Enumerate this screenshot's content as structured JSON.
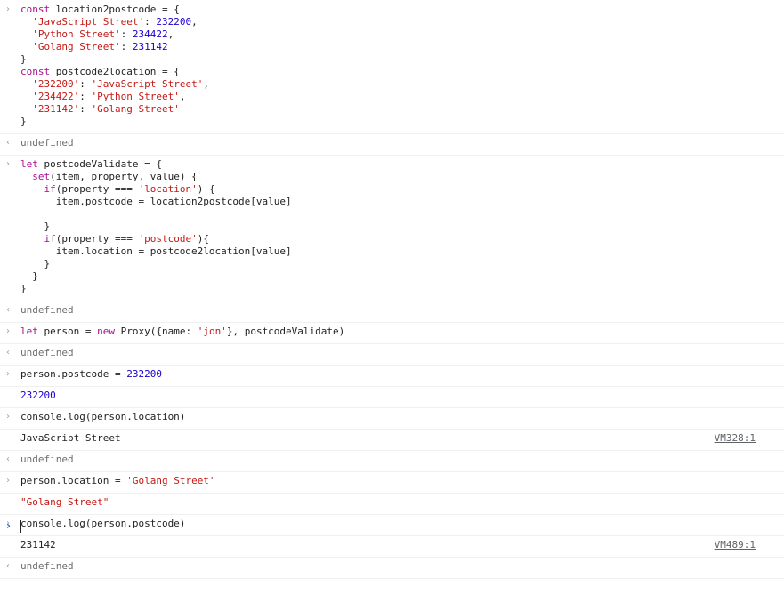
{
  "entries": [
    {
      "kind": "input",
      "lines": [
        "const location2postcode = {",
        "  'JavaScript Street': 232200,",
        "  'Python Street': 234422,",
        "  'Golang Street': 231142",
        "}",
        "const postcode2location = {",
        "  '232200': 'JavaScript Street',",
        "  '234422': 'Python Street',",
        "  '231142': 'Golang Street'",
        "}"
      ]
    },
    {
      "kind": "return",
      "text": "undefined"
    },
    {
      "kind": "input",
      "lines": [
        "let postcodeValidate = {",
        "  set(item, property, value) {",
        "    if(property === 'location') {",
        "      item.postcode = location2postcode[value]",
        "",
        "    }",
        "    if(property === 'postcode'){",
        "      item.location = postcode2location[value]",
        "    }",
        "  }",
        "}"
      ]
    },
    {
      "kind": "return",
      "text": "undefined"
    },
    {
      "kind": "input",
      "lines": [
        "let person = new Proxy({name: 'jon'}, postcodeValidate)"
      ]
    },
    {
      "kind": "return",
      "text": "undefined"
    },
    {
      "kind": "input",
      "lines": [
        "person.postcode = 232200"
      ]
    },
    {
      "kind": "result",
      "text": "232200"
    },
    {
      "kind": "input",
      "lines": [
        "console.log(person.location)"
      ]
    },
    {
      "kind": "log",
      "text": "JavaScript Street",
      "source": "VM328:1"
    },
    {
      "kind": "return",
      "text": "undefined"
    },
    {
      "kind": "input",
      "lines": [
        "person.location = 'Golang Street'"
      ]
    },
    {
      "kind": "result-string",
      "text": "\"Golang Street\""
    },
    {
      "kind": "input",
      "lines": [
        "console.log(person.postcode)"
      ]
    },
    {
      "kind": "log",
      "text": "231142",
      "source": "VM489:1"
    },
    {
      "kind": "return",
      "text": "undefined"
    }
  ],
  "icons": {
    "input": "chevron-right-icon",
    "return": "return-arrow-icon",
    "prompt": "prompt-icon"
  },
  "prompt": {
    "symbol": "›"
  },
  "glyphs": {
    "input": "›",
    "return": "‹"
  }
}
